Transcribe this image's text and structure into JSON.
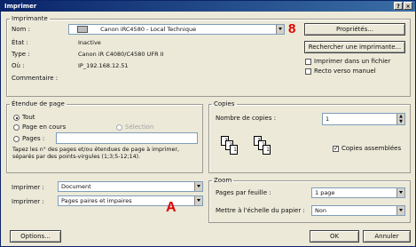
{
  "window": {
    "title": "Imprimer",
    "help": "?",
    "close": "×"
  },
  "printer": {
    "group": "Imprimante",
    "name_label": "Nom :",
    "name_value": "Canon iRC4580 - Local Technique",
    "state_label": "État :",
    "state_value": "Inactive",
    "type_label": "Type :",
    "type_value": "Canon iR C4080/C4580 UFR II",
    "where_label": "Où :",
    "where_value": "IP_192.168.12.51",
    "comment_label": "Commentaire :",
    "properties_button": "Propriétés...",
    "find_button": "Rechercher une imprimante...",
    "print_to_file": "Imprimer dans un fichier",
    "duplex": "Recto verso manuel",
    "annotation_8": "8"
  },
  "range": {
    "group": "Étendue de page",
    "all": "Tout",
    "current": "Page en cours",
    "selection": "Sélection",
    "pages": "Pages :",
    "hint": "Tapez les n° des pages et/ou étendues de page à imprimer, séparés par des points-virgules (1;3;5-12;14)."
  },
  "copies": {
    "group": "Copies",
    "count_label": "Nombre de copies :",
    "count_value": "1",
    "collate": "Copies assemblées"
  },
  "print_what": {
    "label": "Imprimer :",
    "value": "Document"
  },
  "print_sel": {
    "label": "Imprimer :",
    "value": "Pages paires et impaires",
    "annotation_a": "A"
  },
  "zoom": {
    "group": "Zoom",
    "pps_label": "Pages par feuille :",
    "pps_value": "1 page",
    "scale_label": "Mettre à l'échelle du papier :",
    "scale_value": "Non"
  },
  "footer": {
    "options": "Options...",
    "ok": "OK",
    "cancel": "Annuler"
  }
}
